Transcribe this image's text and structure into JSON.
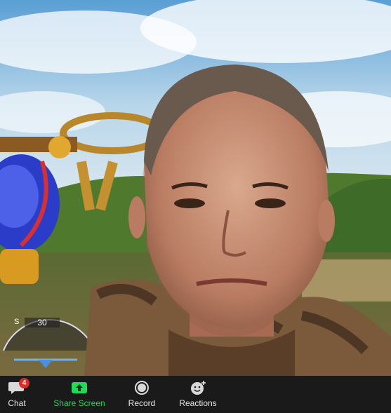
{
  "toolbar": {
    "chat": {
      "label": "Chat",
      "badge": "4",
      "icon": "chat-bubble-icon"
    },
    "share": {
      "label": "Share Screen",
      "icon": "share-screen-icon",
      "accent": "#23d959"
    },
    "record": {
      "label": "Record",
      "icon": "record-icon"
    },
    "reactions": {
      "label": "Reactions",
      "icon": "emoji-plus-icon"
    }
  },
  "video": {
    "hud_speed": "30"
  },
  "colors": {
    "toolbar_bg": "#1a1a1a",
    "toolbar_text": "#e6e6e6",
    "share_green": "#23d959",
    "badge_red": "#e02828"
  }
}
